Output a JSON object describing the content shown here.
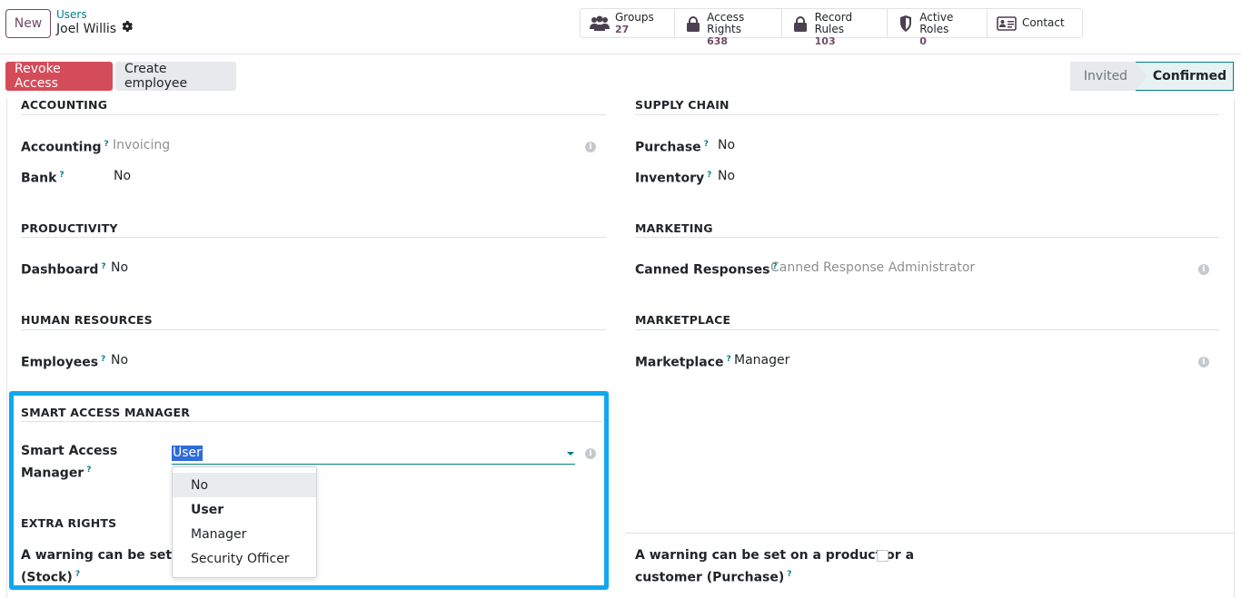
{
  "header": {
    "new_label": "New",
    "breadcrumb_parent": "Users",
    "record_name": "Joel Willis"
  },
  "smart_buttons": [
    {
      "label": "Groups",
      "count": "27",
      "icon": "users-icon"
    },
    {
      "label": "Access Rights",
      "count": "638",
      "icon": "lock-icon"
    },
    {
      "label": "Record Rules",
      "count": "103",
      "icon": "lock-icon"
    },
    {
      "label": "Active Roles",
      "count": "0",
      "icon": "shield-icon"
    },
    {
      "label": "Contact",
      "count": "",
      "icon": "id-card-icon"
    }
  ],
  "status_bar": {
    "revoke_label": "Revoke Access",
    "create_employee_label": "Create employee",
    "stages": [
      "Invited",
      "Confirmed"
    ],
    "current_stage": "Confirmed"
  },
  "sections": {
    "accounting": {
      "title": "ACCOUNTING",
      "fields": [
        {
          "label": "Accounting",
          "value": "Invoicing"
        },
        {
          "label": "Bank",
          "value": "No"
        }
      ]
    },
    "supply_chain": {
      "title": "SUPPLY CHAIN",
      "fields": [
        {
          "label": "Purchase",
          "value": "No"
        },
        {
          "label": "Inventory",
          "value": "No"
        }
      ]
    },
    "productivity": {
      "title": "PRODUCTIVITY",
      "fields": [
        {
          "label": "Dashboard",
          "value": "No"
        }
      ]
    },
    "marketing": {
      "title": "MARKETING",
      "fields": [
        {
          "label": "Canned Responses",
          "value": "Canned Response Administrator"
        }
      ]
    },
    "human_resources": {
      "title": "HUMAN RESOURCES",
      "fields": [
        {
          "label": "Employees",
          "value": "No"
        }
      ]
    },
    "marketplace": {
      "title": "MARKETPLACE",
      "fields": [
        {
          "label": "Marketplace",
          "value": "Manager"
        }
      ]
    },
    "smart_access": {
      "title": "SMART ACCESS MANAGER",
      "field_label_line1": "Smart Access",
      "field_label_line2": "Manager",
      "value": "User",
      "options": [
        "No",
        "User",
        "Manager",
        "Security Officer"
      ]
    },
    "extra_rights": {
      "title": "EXTRA RIGHTS",
      "stock_label_line1": "A warning can be set on a",
      "stock_label_line2": "(Stock)",
      "purchase_label_line1": "A warning can be set on a product or a",
      "purchase_label_line2": "customer (Purchase)"
    }
  },
  "help_marker": "?",
  "colors": {
    "primary": "#714b67",
    "link": "#017e84",
    "danger": "#d44c59",
    "highlight": "#10a7f0"
  }
}
